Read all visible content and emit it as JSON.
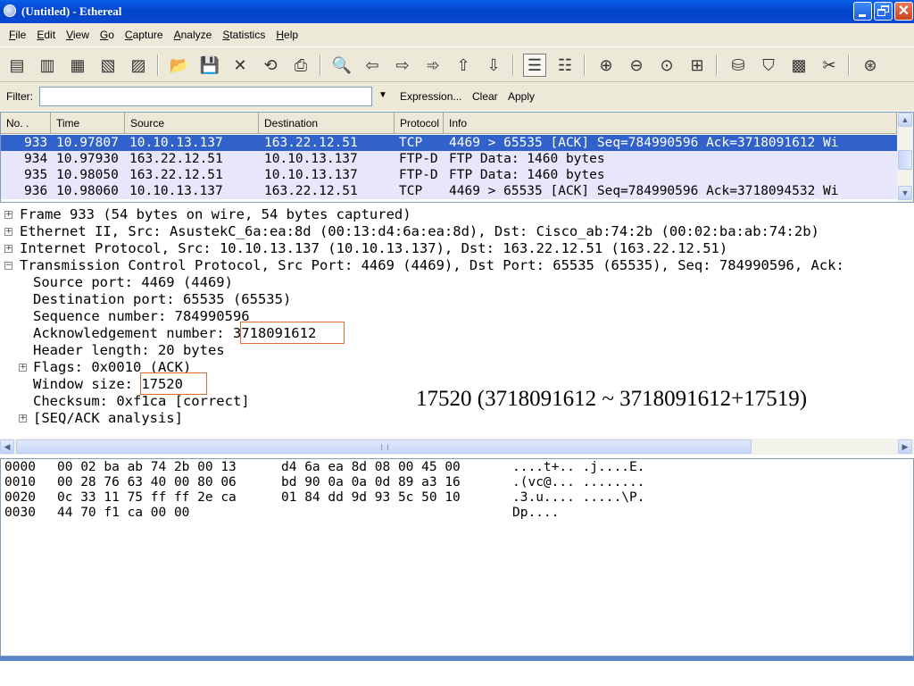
{
  "window": {
    "title": "(Untitled) - Ethereal",
    "minimize_icon": "minimize-icon",
    "maximize_icon": "restore-icon",
    "close_icon": "close-icon",
    "close_glyph": "✕"
  },
  "menu": [
    "File",
    "Edit",
    "View",
    "Go",
    "Capture",
    "Analyze",
    "Statistics",
    "Help"
  ],
  "toolbar": {
    "icons": [
      {
        "name": "interfaces-icon",
        "glyph": "▤"
      },
      {
        "name": "capture-options-icon",
        "glyph": "▥"
      },
      {
        "name": "start-capture-icon",
        "glyph": "▦"
      },
      {
        "name": "stop-capture-icon",
        "glyph": "▧"
      },
      {
        "name": "restart-capture-icon",
        "glyph": "▨"
      },
      {
        "name": "open-folder-icon",
        "glyph": "📂"
      },
      {
        "name": "save-icon",
        "glyph": "💾"
      },
      {
        "name": "close-file-icon",
        "glyph": "✕"
      },
      {
        "name": "reload-icon",
        "glyph": "⟲"
      },
      {
        "name": "print-icon",
        "glyph": "⎙"
      },
      {
        "name": "find-packet-icon",
        "glyph": "🔍"
      },
      {
        "name": "go-back-icon",
        "glyph": "⇦"
      },
      {
        "name": "go-forward-icon",
        "glyph": "⇨"
      },
      {
        "name": "go-to-packet-icon",
        "glyph": "➾"
      },
      {
        "name": "go-first-icon",
        "glyph": "⇧"
      },
      {
        "name": "go-last-icon",
        "glyph": "⇩"
      },
      {
        "name": "colorize-icon",
        "glyph": "☰"
      },
      {
        "name": "auto-scroll-icon",
        "glyph": "☷"
      },
      {
        "name": "zoom-in-icon",
        "glyph": "⊕"
      },
      {
        "name": "zoom-out-icon",
        "glyph": "⊖"
      },
      {
        "name": "zoom-normal-icon",
        "glyph": "⊙"
      },
      {
        "name": "resize-columns-icon",
        "glyph": "⊞"
      },
      {
        "name": "capture-filters-icon",
        "glyph": "⛁"
      },
      {
        "name": "display-filters-icon",
        "glyph": "⛉"
      },
      {
        "name": "coloring-rules-icon",
        "glyph": "▩"
      },
      {
        "name": "preferences-icon",
        "glyph": "✂"
      },
      {
        "name": "help-icon",
        "glyph": "⊛"
      }
    ]
  },
  "filter": {
    "label": "Filter:",
    "value": "",
    "dropdown_icon": "chevron-down-icon",
    "dropdown_glyph": "▼",
    "expression_label": "Expression...",
    "clear_label": "Clear",
    "apply_label": "Apply"
  },
  "packet_list": {
    "columns": [
      "No. .",
      "Time",
      "Source",
      "Destination",
      "Protocol",
      "Info"
    ],
    "rows": [
      {
        "no": "933",
        "time": "10.97807",
        "source": "10.10.13.137",
        "destination": "163.22.12.51",
        "protocol": "TCP",
        "info": "4469 > 65535 [ACK] Seq=784990596 Ack=3718091612 Wi",
        "selected": true
      },
      {
        "no": "934",
        "time": "10.97930",
        "source": "163.22.12.51",
        "destination": "10.10.13.137",
        "protocol": "FTP-D",
        "info": "FTP Data: 1460 bytes",
        "selected": false
      },
      {
        "no": "935",
        "time": "10.98050",
        "source": "163.22.12.51",
        "destination": "10.10.13.137",
        "protocol": "FTP-D",
        "info": "FTP Data: 1460 bytes",
        "selected": false
      },
      {
        "no": "936",
        "time": "10.98060",
        "source": "10.10.13.137",
        "destination": "163.22.12.51",
        "protocol": "TCP",
        "info": "4469 > 65535 [ACK] Seq=784990596 Ack=3718094532 Wi",
        "selected": false
      }
    ],
    "scroll_up_glyph": "▲",
    "scroll_down_glyph": "▼"
  },
  "details": {
    "lines": [
      {
        "expander": "⊞",
        "text": "Frame 933 (54 bytes on wire, 54 bytes captured)"
      },
      {
        "expander": "⊞",
        "text": "Ethernet II, Src: AsustekC_6a:ea:8d (00:13:d4:6a:ea:8d), Dst: Cisco_ab:74:2b (00:02:ba:ab:74:2b)"
      },
      {
        "expander": "⊞",
        "text": "Internet Protocol, Src: 10.10.13.137 (10.10.13.137), Dst: 163.22.12.51 (163.22.12.51)"
      },
      {
        "expander": "⊟",
        "text": "Transmission Control Protocol, Src Port: 4469 (4469), Dst Port: 65535 (65535), Seq: 784990596, Ack:"
      },
      {
        "expander": "",
        "text": "Source port: 4469 (4469)"
      },
      {
        "expander": "",
        "text": "Destination port: 65535 (65535)"
      },
      {
        "expander": "",
        "text": "Sequence number: 784990596"
      },
      {
        "expander": "",
        "text": "Acknowledgement number: 3718091612"
      },
      {
        "expander": "",
        "text": "Header length: 20 bytes"
      },
      {
        "expander": "⊞",
        "text": "Flags: 0x0010 (ACK)"
      },
      {
        "expander": "",
        "text": "Window size: 17520"
      },
      {
        "expander": "",
        "text": "Checksum: 0xf1ca [correct]"
      },
      {
        "expander": "⊞",
        "text": "[SEQ/ACK analysis]"
      }
    ],
    "annotation": "17520 (3718091612 ~ 3718091612+17519)"
  },
  "hex": {
    "lines": [
      {
        "offset": "0000",
        "hex1": "00 02 ba ab 74 2b 00 13",
        "hex2": "d4 6a ea 8d 08 00 45 00",
        "ascii": "....t+.. .j....E."
      },
      {
        "offset": "0010",
        "hex1": "00 28 76 63 40 00 80 06",
        "hex2": "bd 90 0a 0a 0d 89 a3 16",
        "ascii": ".(vc@... ........"
      },
      {
        "offset": "0020",
        "hex1": "0c 33 11 75 ff ff 2e ca",
        "hex2": "01 84 dd 9d 93 5c 50 10",
        "ascii": ".3.u.... .....\\P."
      },
      {
        "offset": "0030",
        "hex1": "44 70 f1 ca 00 00",
        "hex2": "",
        "ascii": "Dp...."
      }
    ]
  },
  "colors": {
    "selected_row": "#3161cb",
    "row_bg": "#e7e6fb",
    "highlight_box": "#e06b2a",
    "chrome": "#ece9d8"
  }
}
